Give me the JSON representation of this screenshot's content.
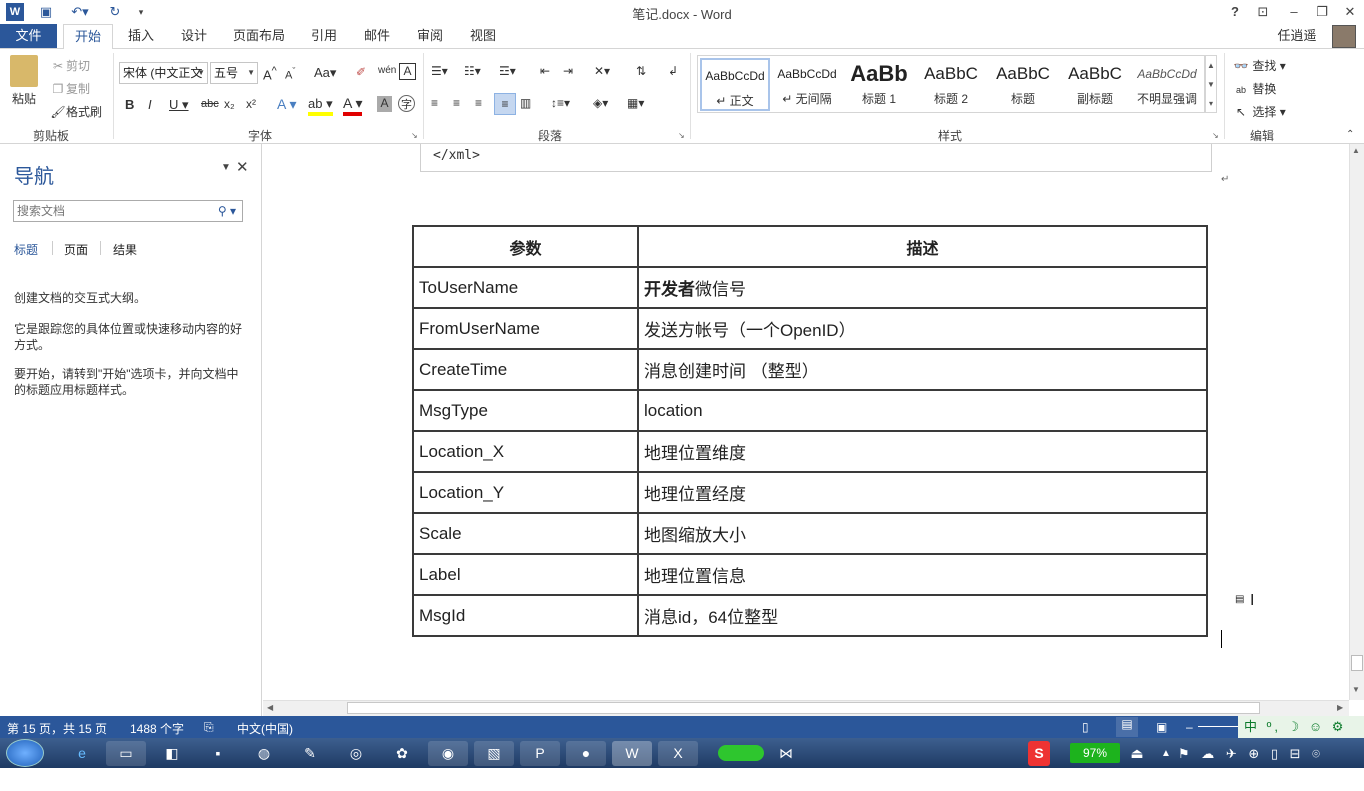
{
  "window": {
    "title": "笔记.docx - Word",
    "help": "?",
    "user": "任逍遥"
  },
  "tabs": [
    "文件",
    "开始",
    "插入",
    "设计",
    "页面布局",
    "引用",
    "邮件",
    "审阅",
    "视图"
  ],
  "ribbon": {
    "clipboard": {
      "paste": "粘贴",
      "cut": "剪切",
      "copy": "复制",
      "format_painter": "格式刷",
      "label": "剪贴板"
    },
    "font": {
      "name": "宋体 (中文正文",
      "size": "五号",
      "label": "字体"
    },
    "paragraph": {
      "label": "段落"
    },
    "styles": {
      "label": "样式",
      "items": [
        {
          "preview": "AaBbCcDd",
          "name": "↵ 正文"
        },
        {
          "preview": "AaBbCcDd",
          "name": "↵ 无间隔"
        },
        {
          "preview": "AaBb",
          "name": "标题 1"
        },
        {
          "preview": "AaBbC",
          "name": "标题 2"
        },
        {
          "preview": "AaBbC",
          "name": "标题"
        },
        {
          "preview": "AaBbC",
          "name": "副标题"
        },
        {
          "preview": "AaBbCcDd",
          "name": "不明显强调"
        }
      ]
    },
    "editing": {
      "find": "查找",
      "replace": "替换",
      "select": "选择",
      "label": "编辑"
    }
  },
  "nav": {
    "title": "导航",
    "search_placeholder": "搜索文档",
    "tabs": [
      "标题",
      "页面",
      "结果"
    ],
    "msg1": "创建文档的交互式大纲。",
    "msg2": "它是跟踪您的具体位置或快速移动内容的好方式。",
    "msg3": "要开始，请转到\"开始\"选项卡，并向文档中的标题应用标题样式。"
  },
  "doc": {
    "xml_close": "</xml>",
    "table": {
      "headers": [
        "参数",
        "描述"
      ],
      "rows": [
        [
          "ToUserName",
          "开发者微信号"
        ],
        [
          "FromUserName",
          "发送方帐号（一个OpenID）"
        ],
        [
          "CreateTime",
          "消息创建时间 （整型）"
        ],
        [
          "MsgType",
          "location"
        ],
        [
          "Location_X",
          "地理位置维度"
        ],
        [
          "Location_Y",
          "地理位置经度"
        ],
        [
          "Scale",
          "地图缩放大小"
        ],
        [
          "Label",
          "地理位置信息"
        ],
        [
          "MsgId",
          "消息id，64位整型"
        ]
      ]
    }
  },
  "status": {
    "page": "第 15 页，共 15 页",
    "words": "1488 个字",
    "lang": "中文(中国)",
    "zoom": "97%"
  }
}
